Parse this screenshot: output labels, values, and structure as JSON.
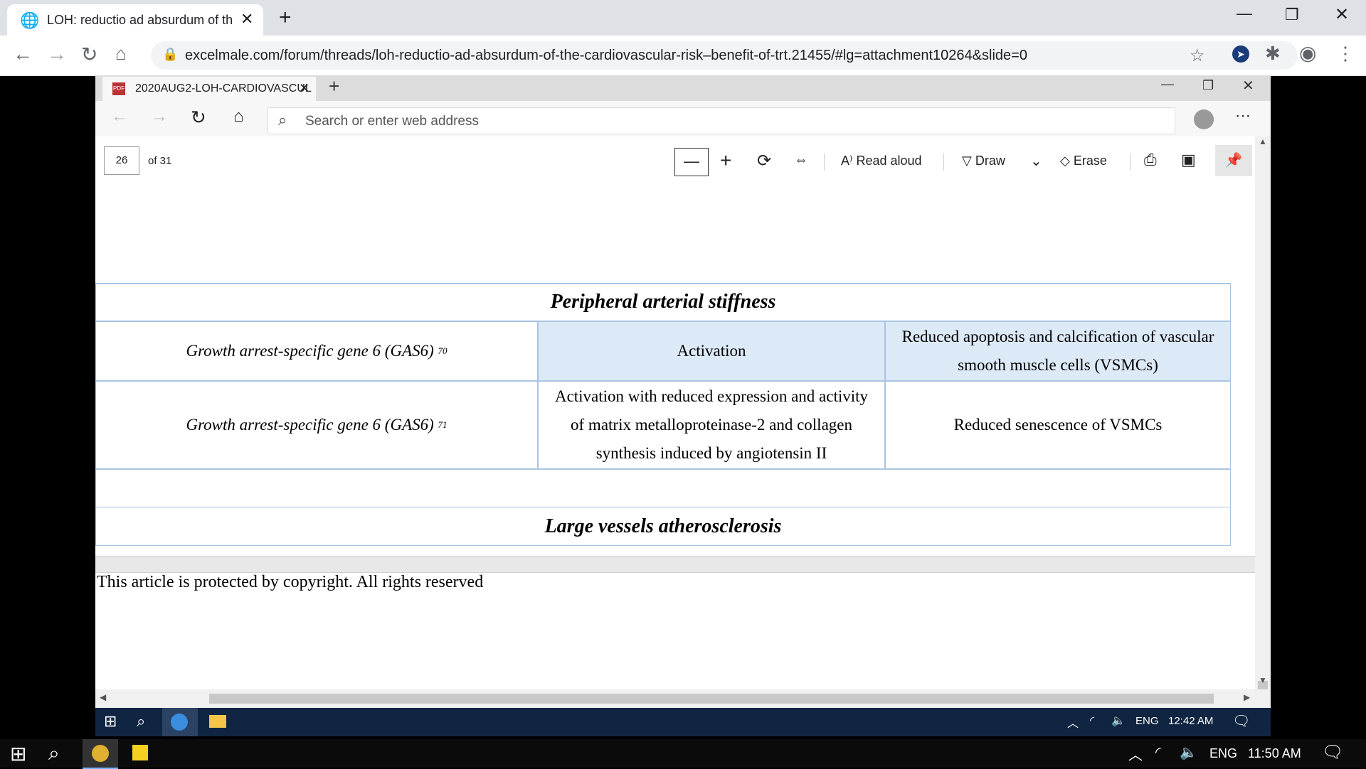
{
  "chrome": {
    "tab_title": "LOH: reductio ad absurdum of th",
    "url_host": "excelmale.com",
    "url_path": "/forum/threads/loh-reductio-ad-absurdum-of-the-cardiovascular-risk–benefit-of-trt.21455/#lg=attachment10264&slide=0"
  },
  "edge": {
    "tab_title": "2020AUG2-LOH-CARDIOVASCUL",
    "address_placeholder": "Search or enter web address"
  },
  "pdf_toolbar": {
    "page_number": "26",
    "page_total": "of 31",
    "read_aloud": "Read aloud",
    "draw": "Draw",
    "erase": "Erase"
  },
  "document": {
    "section1_title": "Peripheral arterial stiffness",
    "rows": [
      {
        "gene": "Growth arrest-specific gene 6 (GAS6)",
        "ref": "70",
        "effect": "Activation",
        "outcome_line1": "Reduced apoptosis and calcification of vascular",
        "outcome_line2": "smooth muscle cells (VSMCs)"
      },
      {
        "gene": "Growth arrest-specific gene 6 (GAS6)",
        "ref": "71",
        "effect_line1": "Activation with reduced expression and activity",
        "effect_line2": "of matrix metalloproteinase-2 and collagen",
        "effect_line3": "synthesis induced by angiotensin II",
        "outcome": "Reduced senescence of VSMCs"
      }
    ],
    "section2_title": "Large vessels atherosclerosis",
    "copyright": "This article is protected by copyright. All rights reserved"
  },
  "edge_taskbar": {
    "lang": "ENG",
    "time": "12:42 AM"
  },
  "win_taskbar": {
    "lang": "ENG",
    "time": "11:50 AM"
  }
}
